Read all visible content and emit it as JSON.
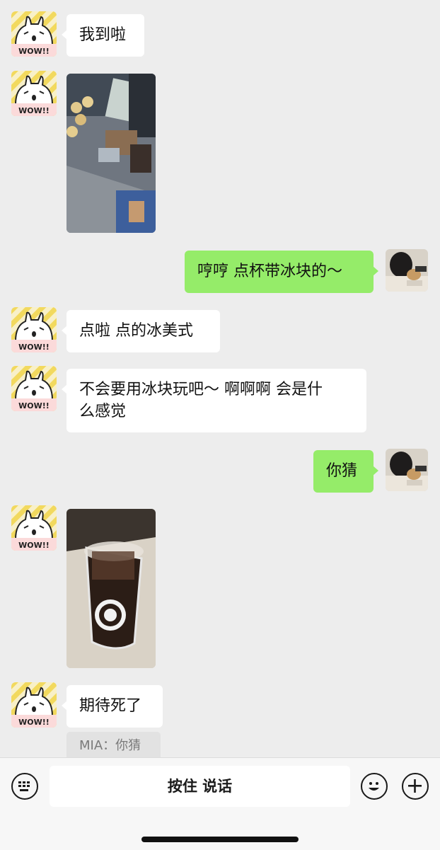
{
  "messages": [
    {
      "side": "left",
      "type": "text",
      "text": "我到啦"
    },
    {
      "side": "left",
      "type": "image",
      "image": "store-counter-photo"
    },
    {
      "side": "right",
      "type": "text",
      "text": "哼哼 点杯带冰块的～"
    },
    {
      "side": "left",
      "type": "text",
      "text": "点啦 点的冰美式"
    },
    {
      "side": "left",
      "type": "text",
      "text": "不会要用冰块玩吧～ 啊啊啊 会是什\n么感觉"
    },
    {
      "side": "right",
      "type": "text",
      "text": "你猜"
    },
    {
      "side": "left",
      "type": "image",
      "image": "iced-coffee-cup-photo"
    },
    {
      "side": "left",
      "type": "text",
      "text": "期待死了"
    }
  ],
  "quote": {
    "text": "MIA：你猜"
  },
  "input_bar": {
    "voice_label": "按住 说话",
    "left_icon": "keyboard-icon",
    "emoji_icon": "emoji-icon",
    "plus_icon": "plus-icon"
  },
  "colors": {
    "background": "#ededed",
    "bubble_self": "#95ec69",
    "bubble_other": "#ffffff"
  }
}
